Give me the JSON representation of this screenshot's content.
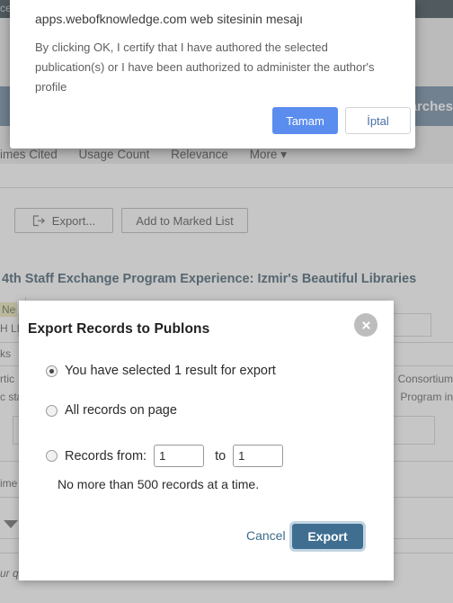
{
  "background": {
    "topbar_text": "ce",
    "bluebar_text": "arches",
    "sort_options": [
      "imes Cited",
      "Usage Count",
      "Relevance",
      "More ▾"
    ],
    "toolbar": {
      "export_label": "Export...",
      "marked_list_label": "Add to Marked List"
    },
    "record": {
      "title": "4th Staff Exchange Program Experience: Izmir's Beautiful Libraries",
      "new_badge": "Ne",
      "left_fragments": [
        "H LI",
        "ks",
        "rtic",
        "c sta",
        "ime",
        "ur q"
      ],
      "right_fragments": [
        "Consortium",
        "Program in"
      ]
    }
  },
  "alert": {
    "title": "apps.webofknowledge.com web sitesinin mesajı",
    "message": "By clicking OK, I certify that I have authored the selected publication(s) or I have been authorized to administer the author's profile",
    "ok_label": "Tamam",
    "cancel_label": "İptal",
    "ok_color": "#5b8def"
  },
  "export_modal": {
    "title": "Export Records to Publons",
    "close_icon": "close-icon",
    "options": [
      {
        "label": "You have selected 1 result for export",
        "selected": true
      },
      {
        "label": "All records on page",
        "selected": false
      },
      {
        "label": "Records from:",
        "selected": false
      }
    ],
    "range": {
      "from_value": "1",
      "to_label": "to",
      "to_value": "1"
    },
    "note": "No more than 500 records at a time.",
    "cancel_label": "Cancel",
    "export_label": "Export",
    "export_color": "#3f6e91"
  }
}
